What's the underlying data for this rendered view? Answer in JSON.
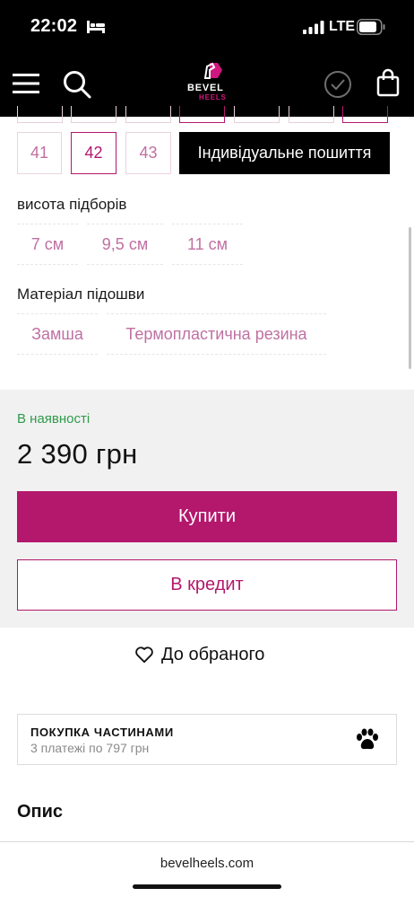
{
  "status_bar": {
    "time": "22:02",
    "network": "LTE"
  },
  "header": {
    "logo_top": "BEVEL",
    "logo_bottom": "HEELS",
    "menu_icon": "hamburger-menu-icon",
    "search_icon": "search-icon",
    "check_icon": "check-circle-icon",
    "bag_icon": "shopping-bag-icon"
  },
  "sizes": {
    "options": [
      "41",
      "42",
      "43"
    ],
    "selected": "42",
    "custom_label": "Індивідуальне пошиття"
  },
  "heel_height": {
    "label": "висота підборів",
    "options": [
      "7 см",
      "9,5 см",
      "11 см"
    ]
  },
  "sole_material": {
    "label": "Матеріал підошви",
    "options": [
      "Замша",
      "Термопластична резина"
    ]
  },
  "purchase": {
    "stock_status": "В наявності",
    "price": "2 390 грн",
    "buy_label": "Купити",
    "credit_label": "В кредит",
    "wishlist_label": "До обраного"
  },
  "installments": {
    "title": "ПОКУПКА ЧАСТИНАМИ",
    "subtitle": "3 платежі по 797 грн",
    "icon": "paw-icon"
  },
  "description": {
    "title": "Опис"
  },
  "browser": {
    "url": "bevelheels.com"
  },
  "colors": {
    "accent": "#b3186c",
    "option_text": "#c070a2",
    "in_stock": "#2e9a4a",
    "panel_bg": "#f1f1f1",
    "header_bg": "#000000"
  }
}
